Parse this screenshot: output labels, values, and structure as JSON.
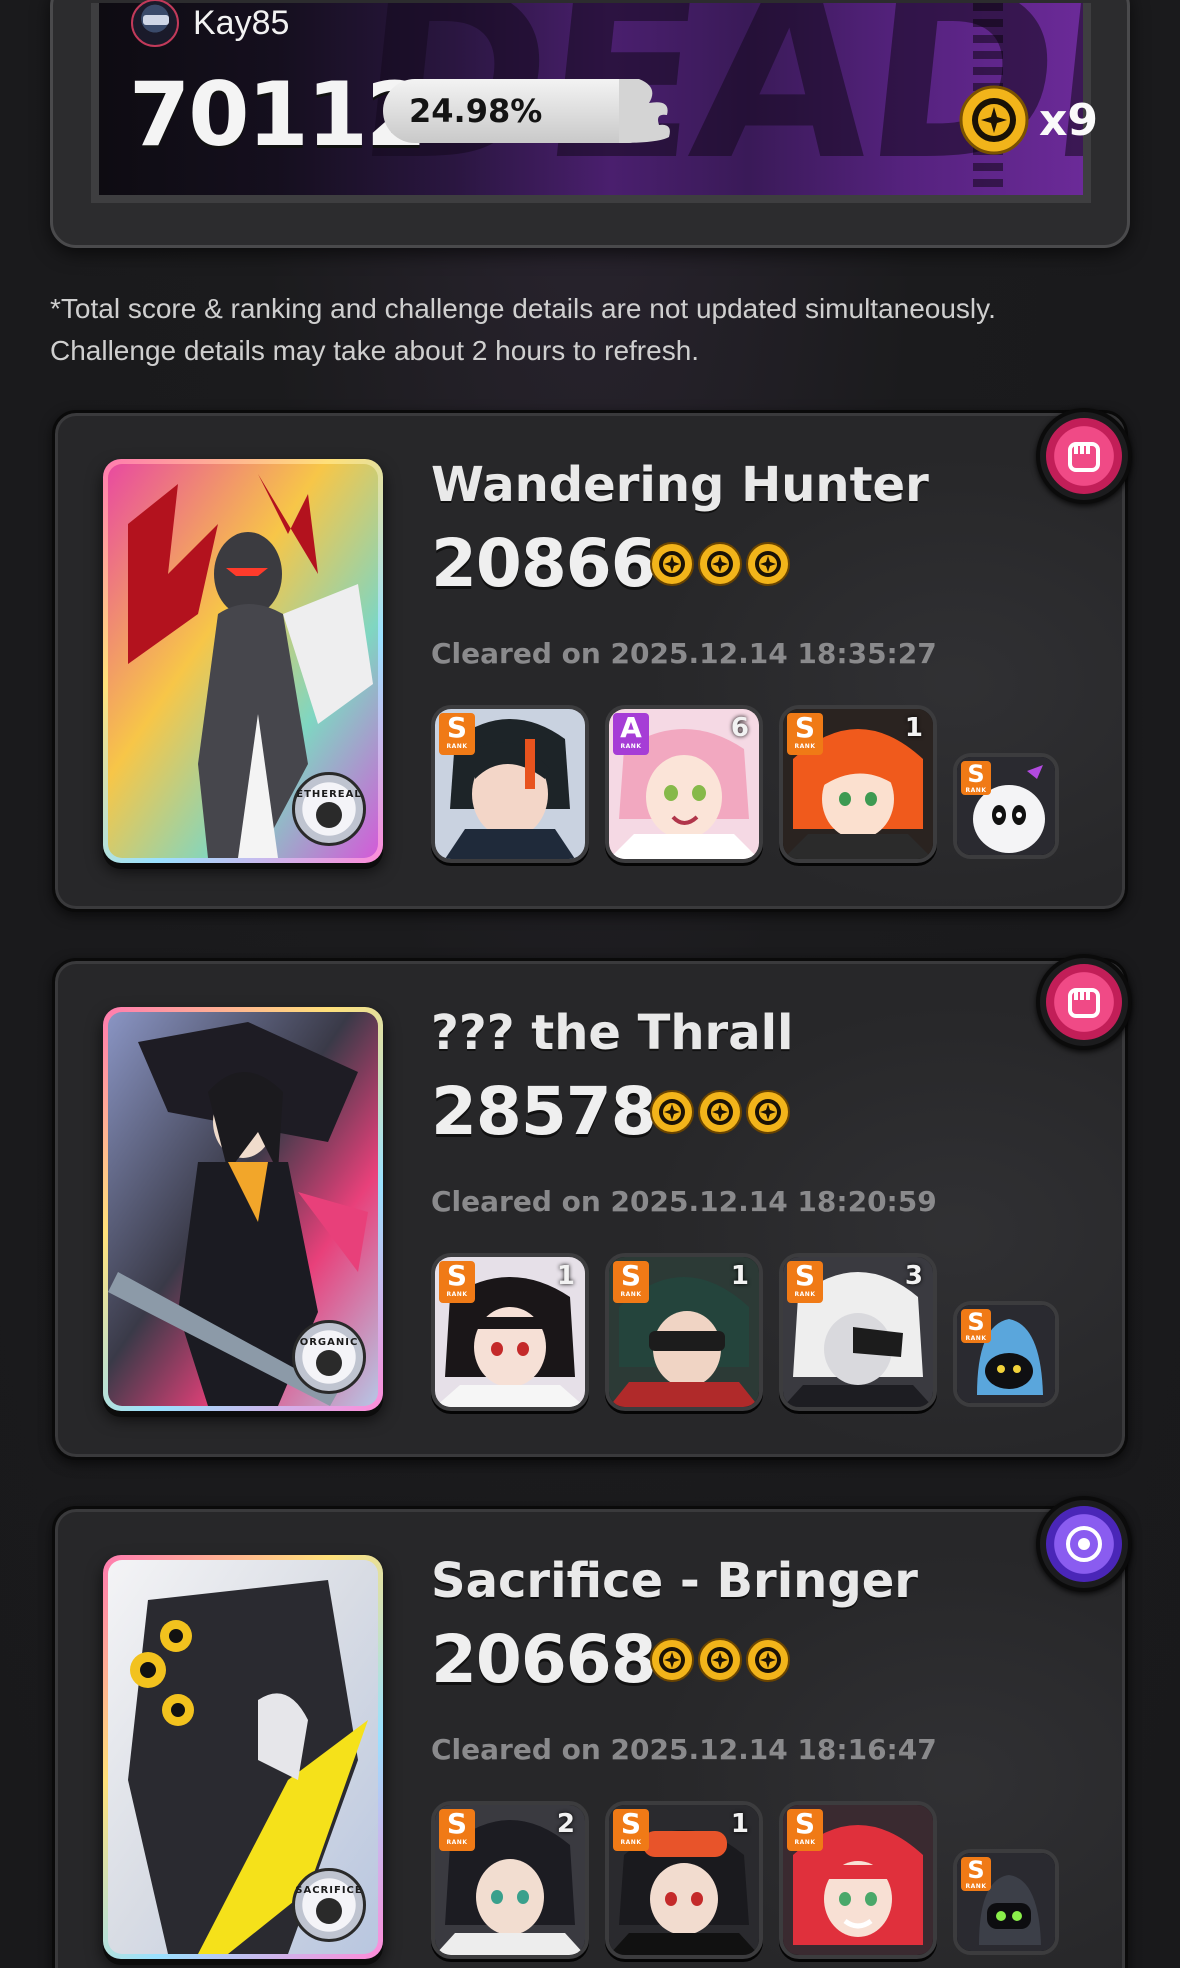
{
  "summary": {
    "username": "Kay85",
    "total_score": "70112",
    "percentile": "24.98%",
    "medal_count": "x9",
    "banner_text": "DEADLY",
    "accent_color": "#6b2a98"
  },
  "note": {
    "line1": "*Total score & ranking and challenge details are not updated simultaneously.",
    "line2": "Challenge details may take about 2 hours to refresh."
  },
  "challenges": [
    {
      "boss_name": "Wandering Hunter",
      "score": "20866",
      "medals": 3,
      "cleared": "Cleared on 2025.12.14 18:35:27",
      "badge_icon": "fist-icon",
      "badge_color": "#e0336e",
      "type_seal": "ETHEREAL",
      "team": [
        {
          "rank": "S",
          "mindscape": ""
        },
        {
          "rank": "A",
          "mindscape": "6"
        },
        {
          "rank": "S",
          "mindscape": "1"
        }
      ],
      "bangboo": {
        "rank": "S"
      }
    },
    {
      "boss_name": "??? the Thrall",
      "score": "28578",
      "medals": 3,
      "cleared": "Cleared on 2025.12.14 18:20:59",
      "badge_icon": "fist-icon",
      "badge_color": "#e0336e",
      "type_seal": "ORGANIC",
      "team": [
        {
          "rank": "S",
          "mindscape": "1"
        },
        {
          "rank": "S",
          "mindscape": "1"
        },
        {
          "rank": "S",
          "mindscape": "3"
        }
      ],
      "bangboo": {
        "rank": "S"
      }
    },
    {
      "boss_name": "Sacrifice - Bringer",
      "score": "20668",
      "medals": 3,
      "cleared": "Cleared on 2025.12.14 18:16:47",
      "badge_icon": "ring-target-icon",
      "badge_color": "#7b46e0",
      "type_seal": "SACRIFICE",
      "team": [
        {
          "rank": "S",
          "mindscape": "2"
        },
        {
          "rank": "S",
          "mindscape": "1"
        },
        {
          "rank": "S",
          "mindscape": ""
        }
      ],
      "bangboo": {
        "rank": "S"
      }
    }
  ],
  "rank_sub_label": "RANK"
}
